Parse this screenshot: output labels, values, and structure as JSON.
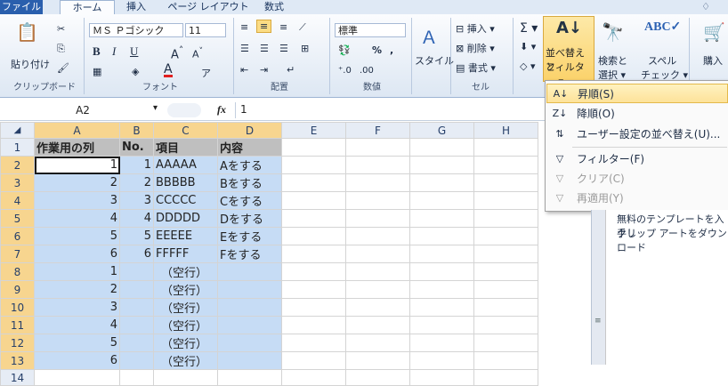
{
  "tabs": [
    "ファイル",
    "ホーム",
    "挿入",
    "ページ レイアウト",
    "数式"
  ],
  "ribbon": {
    "clipboard": {
      "paste": "貼り付け",
      "label": "クリップボード"
    },
    "font": {
      "name": "ＭＳ Ｐゴシック",
      "size": "11",
      "label": "フォント"
    },
    "alignment": {
      "label": "配置"
    },
    "number": {
      "format": "標準",
      "label": "数値"
    },
    "style": {
      "label": "スタイル"
    },
    "cells": {
      "insert": "挿入",
      "delete": "削除",
      "format": "書式",
      "label": "セル"
    },
    "editing": {
      "sort_filter_1": "並べ替えと",
      "sort_filter_2": "フィルター",
      "find_1": "検索と",
      "find_2": "選択",
      "spell_1": "スペル",
      "spell_2": "チェック",
      "buy": "購入"
    }
  },
  "formula_bar": {
    "name_box": "A2",
    "fx": "fx",
    "value": "1"
  },
  "columns": [
    "A",
    "B",
    "C",
    "D",
    "E",
    "F",
    "G",
    "H"
  ],
  "rows": [
    {
      "n": "1",
      "a": "作業用の列",
      "b": "No.",
      "c": "項目",
      "d": "内容"
    },
    {
      "n": "2",
      "a": "1",
      "b": "1",
      "c": "AAAAA",
      "d": "Aをする"
    },
    {
      "n": "3",
      "a": "2",
      "b": "2",
      "c": "BBBBB",
      "d": "Bをする"
    },
    {
      "n": "4",
      "a": "3",
      "b": "3",
      "c": "CCCCC",
      "d": "Cをする"
    },
    {
      "n": "5",
      "a": "4",
      "b": "4",
      "c": "DDDDD",
      "d": "Dをする"
    },
    {
      "n": "6",
      "a": "5",
      "b": "5",
      "c": "EEEEE",
      "d": "Eをする"
    },
    {
      "n": "7",
      "a": "6",
      "b": "6",
      "c": "FFFFF",
      "d": "Fをする"
    },
    {
      "n": "8",
      "a": "1",
      "b": "",
      "c": "（空行）",
      "d": ""
    },
    {
      "n": "9",
      "a": "2",
      "b": "",
      "c": "（空行）",
      "d": ""
    },
    {
      "n": "10",
      "a": "3",
      "b": "",
      "c": "（空行）",
      "d": ""
    },
    {
      "n": "11",
      "a": "4",
      "b": "",
      "c": "（空行）",
      "d": ""
    },
    {
      "n": "12",
      "a": "5",
      "b": "",
      "c": "（空行）",
      "d": ""
    },
    {
      "n": "13",
      "a": "6",
      "b": "",
      "c": "（空行）",
      "d": ""
    },
    {
      "n": "14",
      "a": "",
      "b": "",
      "c": "",
      "d": ""
    }
  ],
  "dropdown": {
    "ascending": "昇順(S)",
    "descending": "降順(O)",
    "custom_sort": "ユーザー設定の並べ替え(U)...",
    "filter": "フィルター(F)",
    "clear": "クリア(C)",
    "reapply": "再適用(Y)"
  },
  "taskpane": {
    "line1": "無料のテンプレートを入手し",
    "line2": "クリップ アートをダウンロード"
  }
}
